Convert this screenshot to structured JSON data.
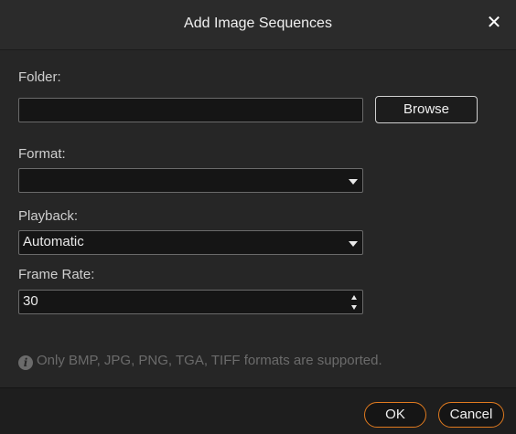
{
  "dialog": {
    "title": "Add Image Sequences",
    "close_icon": "close-icon"
  },
  "folder": {
    "label": "Folder:",
    "value": "",
    "browse_label": "Browse"
  },
  "format": {
    "label": "Format:",
    "selected": ""
  },
  "playback": {
    "label": "Playback:",
    "selected": "Automatic"
  },
  "frame_rate": {
    "label": "Frame Rate:",
    "value": "30"
  },
  "info": {
    "icon": "info-icon",
    "text": "Only BMP, JPG, PNG, TGA, TIFF formats are supported."
  },
  "footer": {
    "ok_label": "OK",
    "cancel_label": "Cancel"
  },
  "colors": {
    "accent": "#e07a1f",
    "background": "#262626",
    "field": "#151515"
  }
}
